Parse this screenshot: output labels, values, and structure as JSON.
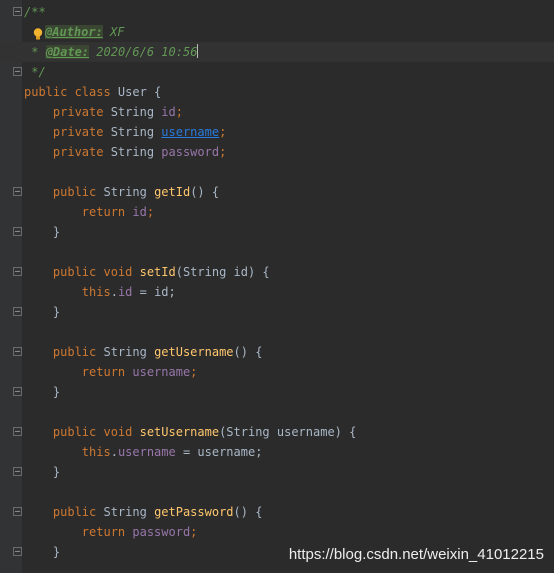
{
  "editor": {
    "language": "java",
    "colors": {
      "background": "#2b2b2b",
      "gutter": "#313335",
      "keyword": "#cc7832",
      "method": "#ffc66d",
      "field": "#9876aa",
      "comment": "#629755",
      "default": "#a9b7c6"
    }
  },
  "code": {
    "l1": "/**",
    "l2_tag": "@Author:",
    "l2_val": " XF",
    "l3_star": " * ",
    "l3_tag": "@Date:",
    "l3_val": " 2020/6/6 10:56",
    "l4": " */",
    "l5_kw": "public class ",
    "l5_rest": "User {",
    "l6_kw": "    private ",
    "l6_type": "String ",
    "l6_field": "id",
    "l6_semi": ";",
    "l7_kw": "    private ",
    "l7_type": "String ",
    "l7_field": "username",
    "l7_semi": ";",
    "l8_kw": "    private ",
    "l8_type": "String ",
    "l8_field": "password",
    "l8_semi": ";",
    "l10_kw": "    public ",
    "l10_type": "String ",
    "l10_fn": "getId",
    "l10_rest": "() {",
    "l11_kw": "        return ",
    "l11_field": "id",
    "l11_semi": ";",
    "l12": "    }",
    "l14_kw": "    public void ",
    "l14_fn": "setId",
    "l14_rest": "(String id) {",
    "l15_kw": "        this",
    "l15_dot": ".",
    "l15_field": "id",
    "l15_rest": " = id;",
    "l16": "    }",
    "l18_kw": "    public ",
    "l18_type": "String ",
    "l18_fn": "getUsername",
    "l18_rest": "() {",
    "l19_kw": "        return ",
    "l19_field": "username",
    "l19_semi": ";",
    "l20": "    }",
    "l22_kw": "    public void ",
    "l22_fn": "setUsername",
    "l22_rest": "(String username) {",
    "l23_kw": "        this",
    "l23_dot": ".",
    "l23_field": "username",
    "l23_rest": " = username;",
    "l24": "    }",
    "l26_kw": "    public ",
    "l26_type": "String ",
    "l26_fn": "getPassword",
    "l26_rest": "() {",
    "l27_kw": "        return ",
    "l27_field": "password",
    "l27_semi": ";",
    "l28": "    }"
  },
  "watermark": "https://blog.csdn.net/weixin_41012215"
}
